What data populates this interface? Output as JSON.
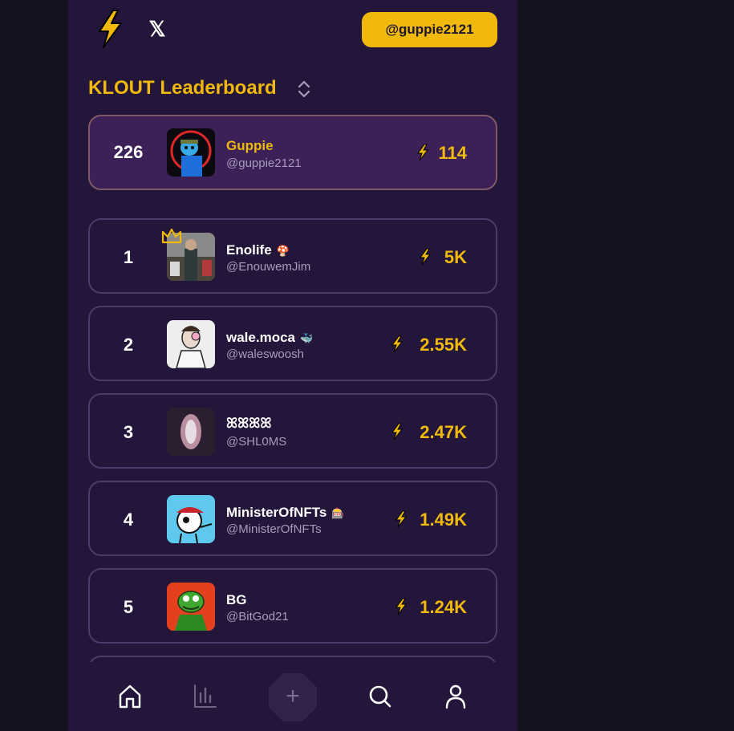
{
  "header": {
    "logo_icon": "lightning-bolt-logo",
    "x_icon": "x-logo-icon",
    "x_glyph": "𝕏",
    "user_button_label": "@guppie2121"
  },
  "leaderboard": {
    "title": "KLOUT Leaderboard",
    "sort_icon": "chevron-up-down-icon"
  },
  "current_user": {
    "rank": "226",
    "name": "Guppie",
    "handle": "@guppie2121",
    "score": "114"
  },
  "entries": [
    {
      "rank": "1",
      "name": "Enolife",
      "emoji": "🍄",
      "handle": "@EnouwemJim",
      "score": "5K",
      "crown": true
    },
    {
      "rank": "2",
      "name": "wale.moca",
      "emoji": "🐳",
      "handle": "@waleswoosh",
      "score": "2.55K"
    },
    {
      "rank": "3",
      "name": "ꕤꕤꕤꕤ",
      "emoji": "",
      "handle": "@SHL0MS",
      "score": "2.47K"
    },
    {
      "rank": "4",
      "name": "MinisterOfNFTs",
      "emoji": "🎰",
      "handle": "@MinisterOfNFTs",
      "score": "1.49K"
    },
    {
      "rank": "5",
      "name": "BG",
      "emoji": "",
      "handle": "@BitGod21",
      "score": "1.24K"
    }
  ],
  "nav": {
    "items": [
      "home-icon",
      "chart-icon",
      "plus-icon",
      "search-icon",
      "profile-icon"
    ],
    "plus_label": "+"
  },
  "colors": {
    "accent": "#f0b90b",
    "background": "#23163a",
    "outer": "#161121",
    "highlight_card": "#3b2157"
  }
}
